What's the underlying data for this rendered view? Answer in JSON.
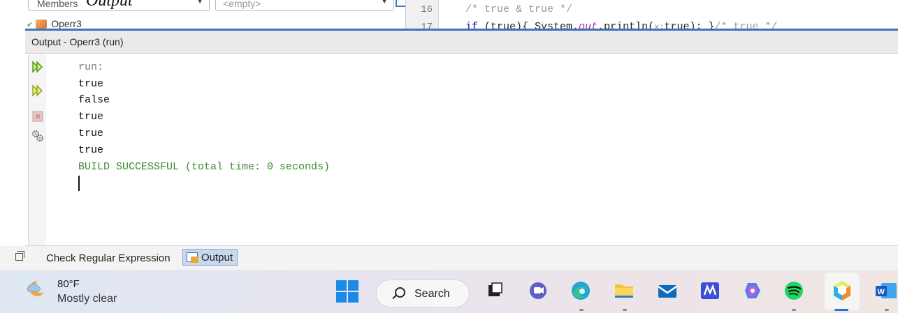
{
  "ide": {
    "members_combo": "Members",
    "empty_combo": "<empty>",
    "overlay_title": "Output",
    "tree_node": "Operr3",
    "line_numbers": [
      "16",
      "17"
    ],
    "code_line_16": "/* true & true */",
    "code_line_17_kw": "if",
    "code_line_17_a": " (true){ System.",
    "code_line_17_out": "out",
    "code_line_17_b": ".println(",
    "code_line_17_hint": "x:",
    "code_line_17_c": "true); }",
    "code_line_17_cm": "/* true */"
  },
  "output": {
    "title": "Output - Operr3 (run)",
    "lines": [
      "run:",
      "true",
      "false",
      "true",
      "true",
      "true",
      "BUILD SUCCESSFUL (total time: 0 seconds)"
    ],
    "colors": {
      "run": "#7a7a7a",
      "normal": "#111111",
      "success": "#3a8a2e"
    }
  },
  "bottom_tabs": {
    "regex": "Check Regular Expression",
    "output": "Output"
  },
  "taskbar": {
    "temperature": "80°F",
    "weather": "Mostly clear",
    "search": "Search",
    "apps": [
      "file-explorer",
      "teams",
      "edge",
      "files",
      "mail",
      "notes",
      "copilot",
      "spotify",
      "netbeans",
      "word"
    ]
  }
}
